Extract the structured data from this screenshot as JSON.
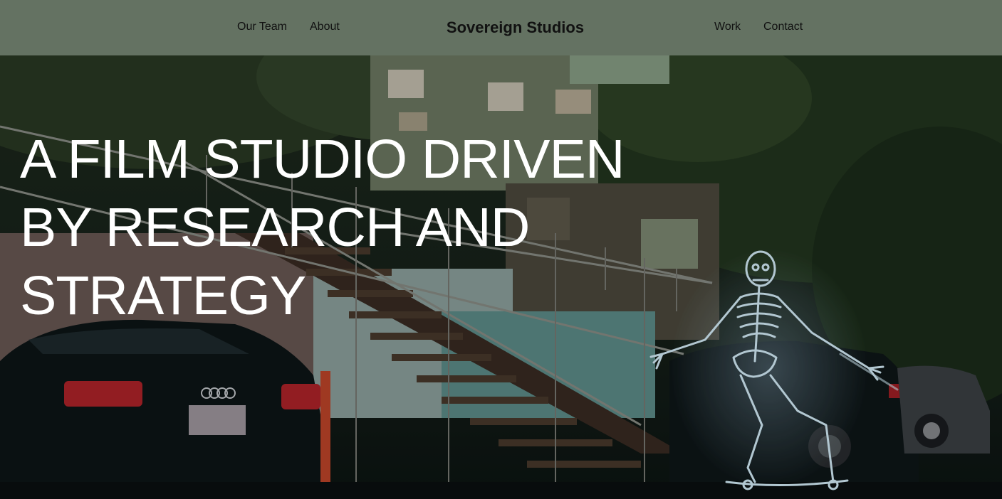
{
  "nav": {
    "brand": "Sovereign Studios",
    "left_links": [
      {
        "label": "Our Team"
      },
      {
        "label": "About"
      }
    ],
    "right_links": [
      {
        "label": "Work"
      },
      {
        "label": "Contact"
      }
    ]
  },
  "hero": {
    "headline_lines": [
      "A FILM STUDIO DRIVEN",
      "BY RESEARCH AND",
      "STRATEGY"
    ],
    "background_description_icon": "night-street-skeleton-skateboard-image"
  },
  "colors": {
    "nav_background": "#647262",
    "nav_text": "#111111",
    "headline_text": "#ffffff"
  }
}
